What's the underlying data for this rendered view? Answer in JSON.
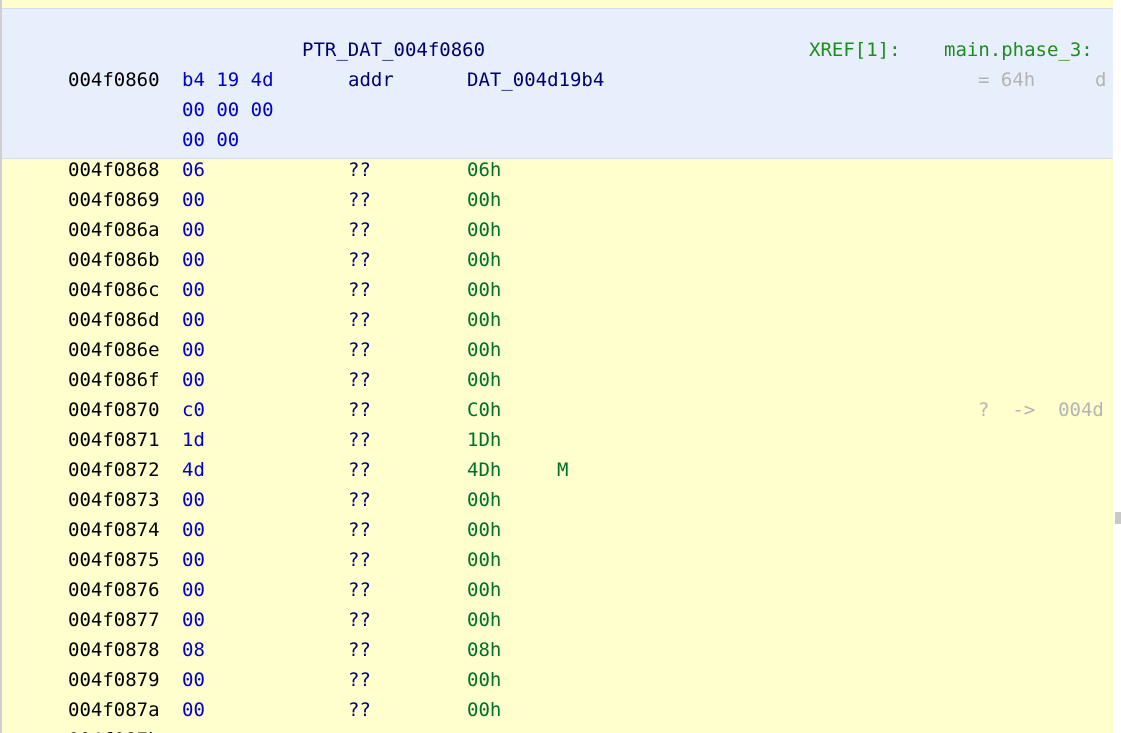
{
  "header": {
    "label": "PTR_DAT_004f0860",
    "xref_label": "XREF[1]:",
    "xref_target": "main.phase_3:",
    "address": "004f0860",
    "bytes_line1": "b4 19 4d",
    "bytes_line2": "00 00 00",
    "bytes_line3": "00 00",
    "mnemonic": "addr",
    "operand": "DAT_004d19b4",
    "comment": "= 64h",
    "comment_extra": "d"
  },
  "rows": [
    {
      "address": "004f0868",
      "byte": "06",
      "mnemonic": "??",
      "value": "06h",
      "char": "",
      "comment": ""
    },
    {
      "address": "004f0869",
      "byte": "00",
      "mnemonic": "??",
      "value": "00h",
      "char": "",
      "comment": ""
    },
    {
      "address": "004f086a",
      "byte": "00",
      "mnemonic": "??",
      "value": "00h",
      "char": "",
      "comment": ""
    },
    {
      "address": "004f086b",
      "byte": "00",
      "mnemonic": "??",
      "value": "00h",
      "char": "",
      "comment": ""
    },
    {
      "address": "004f086c",
      "byte": "00",
      "mnemonic": "??",
      "value": "00h",
      "char": "",
      "comment": ""
    },
    {
      "address": "004f086d",
      "byte": "00",
      "mnemonic": "??",
      "value": "00h",
      "char": "",
      "comment": ""
    },
    {
      "address": "004f086e",
      "byte": "00",
      "mnemonic": "??",
      "value": "00h",
      "char": "",
      "comment": ""
    },
    {
      "address": "004f086f",
      "byte": "00",
      "mnemonic": "??",
      "value": "00h",
      "char": "",
      "comment": ""
    },
    {
      "address": "004f0870",
      "byte": "c0",
      "mnemonic": "??",
      "value": "C0h",
      "char": "",
      "comment": "?  ->  004d"
    },
    {
      "address": "004f0871",
      "byte": "1d",
      "mnemonic": "??",
      "value": "1Dh",
      "char": "",
      "comment": ""
    },
    {
      "address": "004f0872",
      "byte": "4d",
      "mnemonic": "??",
      "value": "4Dh",
      "char": "M",
      "comment": ""
    },
    {
      "address": "004f0873",
      "byte": "00",
      "mnemonic": "??",
      "value": "00h",
      "char": "",
      "comment": ""
    },
    {
      "address": "004f0874",
      "byte": "00",
      "mnemonic": "??",
      "value": "00h",
      "char": "",
      "comment": ""
    },
    {
      "address": "004f0875",
      "byte": "00",
      "mnemonic": "??",
      "value": "00h",
      "char": "",
      "comment": ""
    },
    {
      "address": "004f0876",
      "byte": "00",
      "mnemonic": "??",
      "value": "00h",
      "char": "",
      "comment": ""
    },
    {
      "address": "004f0877",
      "byte": "00",
      "mnemonic": "??",
      "value": "00h",
      "char": "",
      "comment": ""
    },
    {
      "address": "004f0878",
      "byte": "08",
      "mnemonic": "??",
      "value": "08h",
      "char": "",
      "comment": ""
    },
    {
      "address": "004f0879",
      "byte": "00",
      "mnemonic": "??",
      "value": "00h",
      "char": "",
      "comment": ""
    },
    {
      "address": "004f087a",
      "byte": "00",
      "mnemonic": "??",
      "value": "00h",
      "char": "",
      "comment": ""
    }
  ],
  "colors": {
    "background": "#ffffcd",
    "header_background": "#e6effb",
    "bytes": "#0000c8",
    "value": "#007028",
    "xref": "#1e8c1e",
    "comment": "#b4b4b4"
  }
}
